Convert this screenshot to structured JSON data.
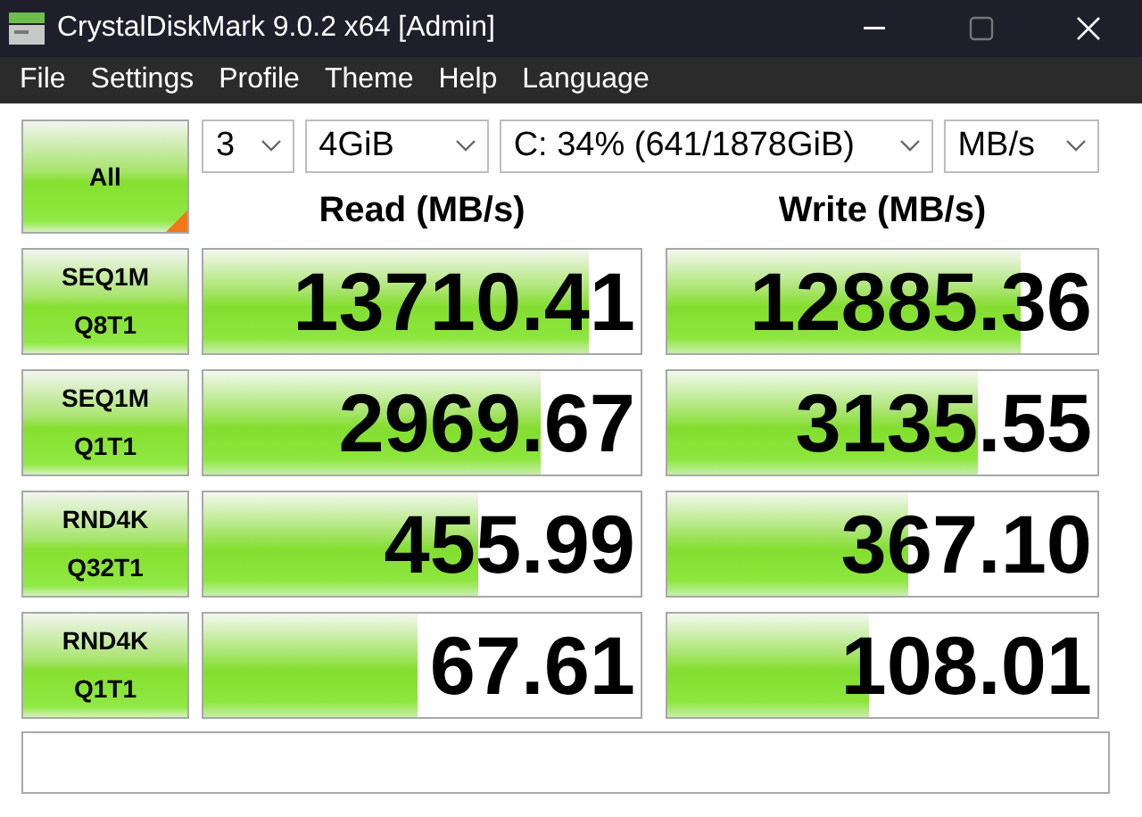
{
  "window": {
    "title": "CrystalDiskMark 9.0.2 x64 [Admin]"
  },
  "menu": [
    "File",
    "Settings",
    "Profile",
    "Theme",
    "Help",
    "Language"
  ],
  "all_button": {
    "label": "All"
  },
  "selects": [
    {
      "value": "3"
    },
    {
      "value": "4GiB"
    },
    {
      "value": "C: 34% (641/1878GiB)"
    },
    {
      "value": "MB/s"
    }
  ],
  "headers": [
    "Read (MB/s)",
    "Write (MB/s)"
  ],
  "tests": [
    {
      "label_lines": [
        "SEQ1M",
        "Q8T1"
      ],
      "read": {
        "value": "13710.41",
        "level": 0.88
      },
      "write": {
        "value": "12885.36",
        "level": 0.82
      }
    },
    {
      "label_lines": [
        "SEQ1M",
        "Q1T1"
      ],
      "read": {
        "value": "2969.67",
        "level": 0.77
      },
      "write": {
        "value": "3135.55",
        "level": 0.72
      }
    },
    {
      "label_lines": [
        "RND4K",
        "Q32T1"
      ],
      "read": {
        "value": "455.99",
        "level": 0.63
      },
      "write": {
        "value": "367.10",
        "level": 0.56
      }
    },
    {
      "label_lines": [
        "RND4K",
        "Q1T1"
      ],
      "read": {
        "value": "67.61",
        "level": 0.49
      },
      "write": {
        "value": "108.01",
        "level": 0.47
      }
    }
  ]
}
